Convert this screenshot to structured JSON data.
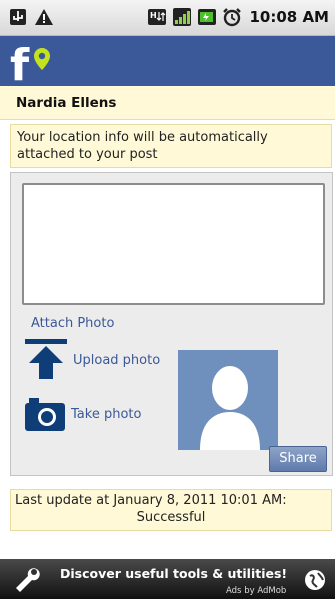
{
  "status_bar": {
    "time": "10:08 AM",
    "icons": [
      "usb-icon",
      "warning-icon",
      "h-network-icon",
      "signal-icon",
      "battery-icon",
      "alarm-icon"
    ]
  },
  "app_header": {
    "logo_icon": "facebook-places-logo"
  },
  "user": {
    "name": "Nardia Ellens"
  },
  "location_info": {
    "text": "Your location info will be automatically attached to your post"
  },
  "post_panel": {
    "textarea_value": "",
    "attach_label": "Attach Photo",
    "upload_label": "Upload photo",
    "take_photo_label": "Take photo",
    "share_label": "Share"
  },
  "last_update": {
    "line1": "Last update at January 8, 2011 10:01 AM:",
    "line2": "Successful"
  },
  "ad": {
    "text": "Discover useful tools & utilities!",
    "by": "Ads by AdMob"
  },
  "colors": {
    "header": "#3b5998",
    "info_bg": "#fff9d7",
    "link": "#3b5998",
    "avatar": "#6f8fbd"
  }
}
